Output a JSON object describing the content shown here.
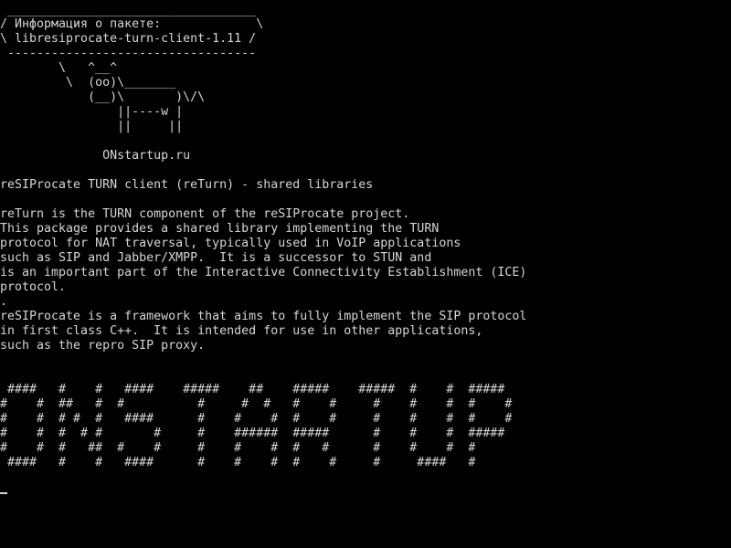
{
  "terminal": {
    "colors": {
      "background": "#000000",
      "foreground": "#d6d6d6"
    },
    "lines": [
      " __________________________________",
      "/ Информация о пакете:             \\",
      "\\ libresiprocate-turn-client-1.11 /",
      " ----------------------------------",
      "        \\   ^__^",
      "         \\  (oo)\\_______",
      "            (__)\\       )\\/\\",
      "                ||----w |",
      "                ||     ||",
      "",
      "              ONstartup.ru",
      "",
      "reSIProcate TURN client (reTurn) - shared libraries",
      "",
      "reTurn is the TURN component of the reSIProcate project.",
      "This package provides a shared library implementing the TURN",
      "protocol for NAT traversal, typically used in VoIP applications",
      "such as SIP and Jabber/XMPP.  It is a successor to STUN and",
      "is an important part of the Interactive Connectivity Establishment (ICE)",
      "protocol.",
      ".",
      "reSIProcate is a framework that aims to fully implement the SIP protocol",
      "in first class C++.  It is intended for use in other applications,",
      "such as the repro SIP proxy.",
      "",
      "",
      " ####   #    #   ####    #####    ##    #####    #####  #    #  #####",
      "#    #  ##   #  #          #     #  #   #    #     #    #    #  #    #",
      "#    #  # #  #   ####      #    #    #  #    #     #    #    #  #    #",
      "#    #  #  # #       #     #    ######  #####      #    #    #  #####",
      "#    #  #   ##  #    #     #    #    #  #   #      #    #    #  #",
      " ####   #    #   ####      #    #    #  #    #     #     ####   #"
    ]
  }
}
